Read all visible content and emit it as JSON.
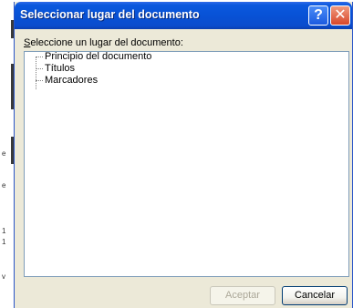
{
  "dialog": {
    "title": "Seleccionar lugar del documento",
    "help_glyph": "?",
    "close_glyph": "✕",
    "prompt_prefix": "S",
    "prompt_rest": "eleccione un lugar del documento:",
    "tree_items": [
      {
        "label": "Principio del documento"
      },
      {
        "label": "Títulos"
      },
      {
        "label": "Marcadores"
      }
    ],
    "accept_label": "Aceptar",
    "cancel_label": "Cancelar"
  },
  "background_marks": [
    "e",
    "e",
    "1",
    "1",
    "v"
  ],
  "colors": {
    "titlebar": "#0a58de",
    "dialog_bg": "#ece9d8",
    "close_red": "#d8472a"
  }
}
